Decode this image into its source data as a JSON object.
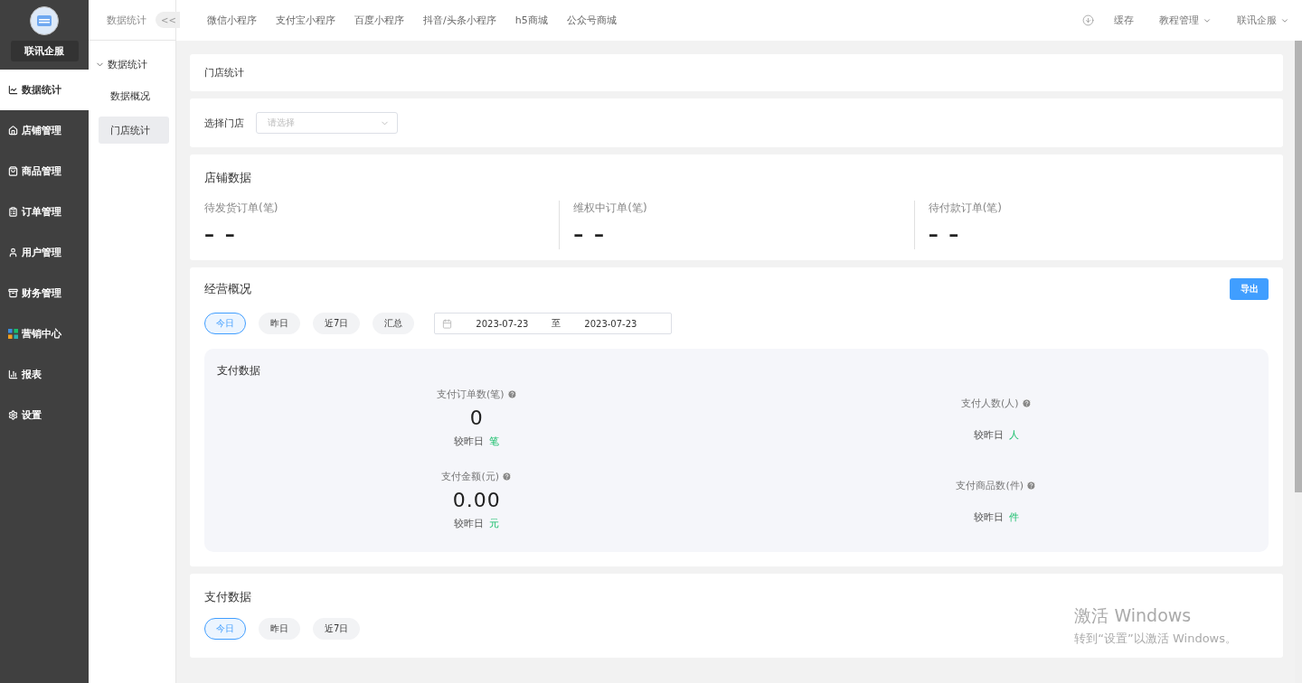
{
  "brand": {
    "name": "联讯企服"
  },
  "nav": [
    {
      "label": "数据统计",
      "selected": true
    },
    {
      "label": "店铺管理",
      "selected": false
    },
    {
      "label": "商品管理",
      "selected": false
    },
    {
      "label": "订单管理",
      "selected": false
    },
    {
      "label": "用户管理",
      "selected": false
    },
    {
      "label": "财务管理",
      "selected": false
    },
    {
      "label": "营销中心",
      "selected": false
    },
    {
      "label": "报表",
      "selected": false
    },
    {
      "label": "设置",
      "selected": false
    }
  ],
  "subnav": {
    "title": "数据统计",
    "collapse": "<<",
    "group": {
      "label": "数据统计",
      "expanded": true,
      "items": [
        {
          "label": "数据概况",
          "selected": false
        },
        {
          "label": "门店统计",
          "selected": true
        }
      ]
    }
  },
  "topbar": {
    "links": [
      "微信小程序",
      "支付宝小程序",
      "百度小程序",
      "抖音/头条小程序",
      "h5商城",
      "公众号商城"
    ],
    "cache": "缓存",
    "menus": [
      "教程管理",
      "联讯企服"
    ]
  },
  "page_title": "门店统计",
  "filter": {
    "label": "选择门店",
    "placeholder": "请选择"
  },
  "store_data": {
    "title": "店铺数据",
    "stats": [
      {
        "label": "待发货订单(笔)",
        "value": "– –"
      },
      {
        "label": "维权中订单(笔)",
        "value": "– –"
      },
      {
        "label": "待付款订单(笔)",
        "value": "– –"
      }
    ]
  },
  "overview": {
    "title": "经营概况",
    "export": "导出",
    "ranges": [
      {
        "label": "今日",
        "selected": true
      },
      {
        "label": "昨日",
        "selected": false
      },
      {
        "label": "近7日",
        "selected": false
      },
      {
        "label": "汇总",
        "selected": false
      }
    ],
    "date_from": "2023-07-23",
    "date_sep": "至",
    "date_to": "2023-07-23",
    "panel": {
      "title": "支付数据",
      "metrics": [
        {
          "label": "支付订单数(笔)",
          "value": "0",
          "compare": "较昨日",
          "unit": "笔"
        },
        {
          "label": "支付人数(人)",
          "compare": "较昨日",
          "unit": "人"
        },
        {
          "label": "支付金额(元)",
          "value": "0.00",
          "compare": "较昨日",
          "unit": "元"
        },
        {
          "label": "支付商品数(件)",
          "compare": "较昨日",
          "unit": "件"
        }
      ]
    }
  },
  "payment": {
    "title": "支付数据",
    "ranges": [
      {
        "label": "今日",
        "selected": true
      },
      {
        "label": "昨日",
        "selected": false
      },
      {
        "label": "近7日",
        "selected": false
      }
    ]
  },
  "os_notice": {
    "title": "激活 Windows",
    "text": "转到“设置”以激活 Windows。"
  }
}
